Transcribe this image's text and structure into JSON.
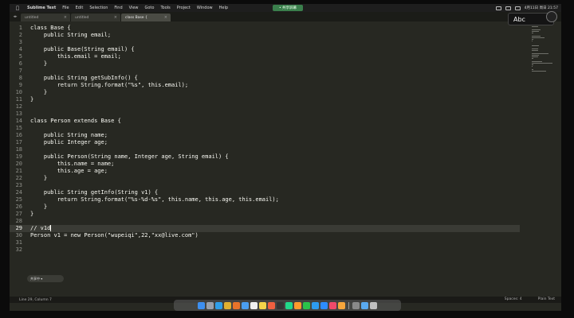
{
  "menubar": {
    "app_name": "Sublime Text",
    "items": [
      "File",
      "Edit",
      "Selection",
      "Find",
      "View",
      "Goto",
      "Tools",
      "Project",
      "Window",
      "Help"
    ],
    "center_label": "• 共享屏幕",
    "status_text": "4月11日 周日 21:57"
  },
  "ime": {
    "text": "Abc"
  },
  "tabs": [
    {
      "label": "untitled"
    },
    {
      "label": "untitled"
    },
    {
      "label": "class Base {"
    }
  ],
  "editor": {
    "lines": [
      {
        "n": "1",
        "text": "class Base {"
      },
      {
        "n": "2",
        "text": "    public String email;"
      },
      {
        "n": "3",
        "text": ""
      },
      {
        "n": "4",
        "text": "    public Base(String email) {"
      },
      {
        "n": "5",
        "text": "        this.email = email;"
      },
      {
        "n": "6",
        "text": "    }"
      },
      {
        "n": "7",
        "text": ""
      },
      {
        "n": "8",
        "text": "    public String getSubInfo() {"
      },
      {
        "n": "9",
        "text": "        return String.format(\"%s\", this.email);"
      },
      {
        "n": "10",
        "text": "    }"
      },
      {
        "n": "11",
        "text": "}"
      },
      {
        "n": "12",
        "text": ""
      },
      {
        "n": "13",
        "text": ""
      },
      {
        "n": "14",
        "text": "class Person extends Base {"
      },
      {
        "n": "15",
        "text": ""
      },
      {
        "n": "16",
        "text": "    public String name;"
      },
      {
        "n": "17",
        "text": "    public Integer age;"
      },
      {
        "n": "18",
        "text": ""
      },
      {
        "n": "19",
        "text": "    public Person(String name, Integer age, String email) {"
      },
      {
        "n": "20",
        "text": "        this.name = name;"
      },
      {
        "n": "21",
        "text": "        this.age = age;"
      },
      {
        "n": "22",
        "text": "    }"
      },
      {
        "n": "23",
        "text": ""
      },
      {
        "n": "24",
        "text": "    public String getInfo(String v1) {"
      },
      {
        "n": "25",
        "text": "        return String.format(\"%s-%d-%s\", this.name, this.age, this.email);"
      },
      {
        "n": "26",
        "text": "    }"
      },
      {
        "n": "27",
        "text": "}"
      },
      {
        "n": "28",
        "text": ""
      },
      {
        "n": "29",
        "text": "// v1d",
        "current": true
      },
      {
        "n": "30",
        "text": "Person v1 = new Person(\"wupeiqi\",22,\"xx@live.com\")"
      },
      {
        "n": "31",
        "text": ""
      },
      {
        "n": "32",
        "text": ""
      }
    ]
  },
  "chip": {
    "label": "共享中 ▾"
  },
  "statusbar": {
    "position": "Line 29, Column 7",
    "tab_size": "Spaces: 4",
    "syntax": "Plain Text"
  },
  "colors": {
    "editor_bg": "#272822",
    "text": "#f8f8f2",
    "gutter_text": "#8f908a",
    "current_line": "#3a3b35"
  },
  "dock": {
    "icons": [
      "finder-icon",
      "launchpad-icon",
      "safari-icon",
      "chrome-icon",
      "firefox-icon",
      "mail-icon",
      "calendar-icon",
      "notes-icon",
      "reminders-icon",
      "terminal-icon",
      "pycharm-icon",
      "sublime-icon",
      "wechat-icon",
      "qq-icon",
      "zoom-icon",
      "music-icon",
      "photos-icon",
      "preferences-icon",
      "folder-icon",
      "trash-icon"
    ]
  }
}
